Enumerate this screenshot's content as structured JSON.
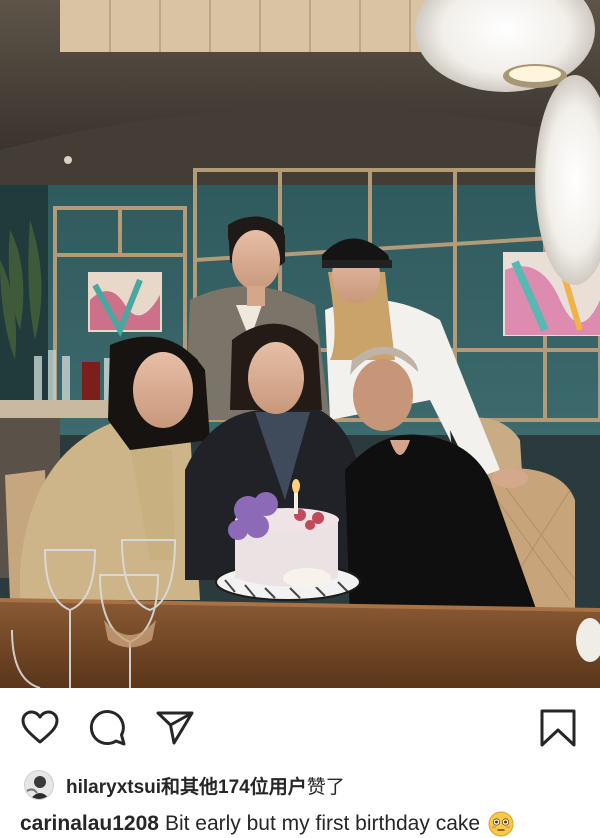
{
  "post": {
    "photo_alt": "photo",
    "actions": {
      "like_icon": "heart-icon",
      "comment_icon": "comment-icon",
      "share_icon": "send-icon",
      "save_icon": "bookmark-icon"
    },
    "likes": {
      "liker_username": "hilaryxtsui",
      "liker_suffix_bold": "和其他174位用户",
      "liker_suffix_plain": "赞了"
    },
    "caption": {
      "username": "carinalau1208",
      "text": "Bit early but my first birthday cake",
      "emoji": "flushed-face-emoji"
    }
  },
  "colors": {
    "text": "#262626",
    "background": "#ffffff",
    "emoji_yellow": "#f7c948"
  }
}
